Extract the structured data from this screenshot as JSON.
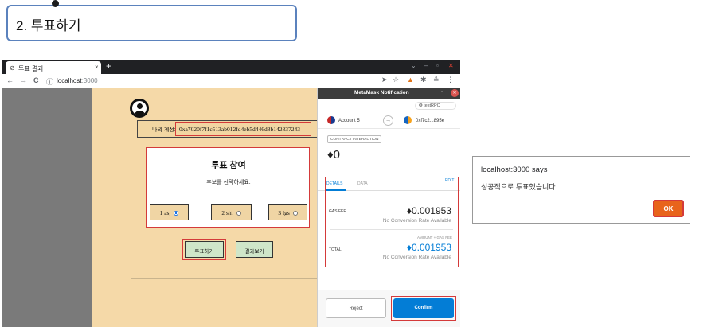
{
  "step": {
    "title": "2. 투표하기"
  },
  "browser": {
    "tab_title": "투표 결과",
    "tab_close": "×",
    "new_tab": "+",
    "nav": {
      "back": "←",
      "forward": "→",
      "reload": "C",
      "info": "ⓘ"
    },
    "url_host": "localhost",
    "url_port": ":3000",
    "window_controls": {
      "dropdown": "⌄",
      "minimize": "–",
      "maximize": "▫",
      "close": "✕"
    },
    "tools": {
      "send": "➤",
      "star": "☆",
      "ext": "✱",
      "profile": "≗",
      "menu": "⋮"
    }
  },
  "app": {
    "account_label": "나의 계정:",
    "account_address": "0xa7020f7f1c513ab012fd4eb5d446d8b142837243",
    "vote_title": "투표 참여",
    "vote_subtitle": "후보를 선택하세요.",
    "candidates": [
      {
        "label": "1 asj",
        "selected": true
      },
      {
        "label": "2 shl",
        "selected": false
      },
      {
        "label": "3 lgs",
        "selected": false
      }
    ],
    "vote_button": "투표하기",
    "results_button": "결과보기"
  },
  "metamask": {
    "title": "MetaMask Notification",
    "network": "testRPC",
    "from_account": "Account 5",
    "to_account": "0xf7c2...895e",
    "arrow": "→",
    "contract_label": "CONTRACT INTERACTION",
    "value": "0",
    "eth_symbol": "♦",
    "tabs": [
      "DETAILS",
      "DATA"
    ],
    "edit": "EDIT",
    "gas_fee_label": "GAS FEE",
    "gas_fee_value": "0.001953",
    "gas_fee_conv": "No Conversion Rate Available",
    "total_caption": "AMOUNT + GAS FEE",
    "total_label": "TOTAL",
    "total_value": "0.001953",
    "total_conv": "No Conversion Rate Available",
    "reject": "Reject",
    "confirm": "Confirm",
    "colors": {
      "accent": "#037dd6",
      "highlight": "#d43a3a"
    }
  },
  "alert": {
    "title": "localhost:3000 says",
    "message": "성공적으로 투표했습니다.",
    "ok": "OK",
    "ok_color": "#e8641b"
  }
}
